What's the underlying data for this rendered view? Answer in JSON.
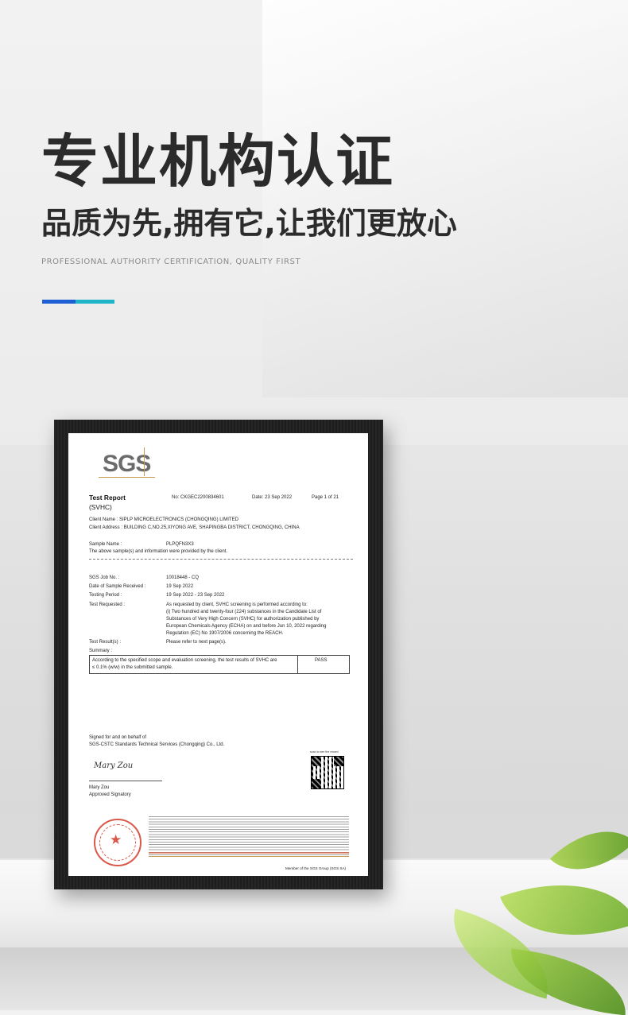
{
  "header": {
    "title": "专业机构认证",
    "subtitle": "品质为先,拥有它,让我们更放心",
    "tagline": "PROFESSIONAL AUTHORITY CERTIFICATION, QUALITY FIRST",
    "accent_colors": [
      "#1f5fd6",
      "#1fb4c8"
    ]
  },
  "certificate": {
    "logo": "SGS",
    "report_title_1": "Test Report",
    "report_title_2": "(SVHC)",
    "report_no": "No: CKGEC2200834601",
    "date": "Date: 23 Sep 2022",
    "page": "Page 1 of 21",
    "client_name": "Client Name :    SIPLP MICROELECTRONICS (CHONGQING) LIMITED",
    "client_address": "Client Address : BUILDING C,NO.25,XIYONG AVE, SHAPINGBA DISTRICT, CHONGQING, CHINA",
    "sample_name_label": "Sample Name :",
    "sample_name_value": "PLPQFN3X3",
    "sample_note": "The above sample(s) and information were provided by the client.",
    "job_no_label": "SGS Job No. :",
    "job_no_value": "10018448 - CQ",
    "date_received_label": "Date of Sample Received :",
    "date_received_value": "19 Sep 2022",
    "testing_period_label": "Testing Period :",
    "testing_period_value": "19 Sep 2022 - 23 Sep 2022",
    "test_requested_label": "Test Requested :",
    "test_requested_lines": [
      "As requested by client, SVHC screening is performed according to:",
      "(i) Two hundred and twenty-four (224) substances in the Candidate List of",
      "Substances of Very High Concern (SVHC) for authorization published by",
      "European Chemicals Agency (ECHA) on and before Jun 10, 2022 regarding",
      "Regulation (EC) No 1907/2006 concerning the REACH."
    ],
    "test_results_label": "Test Result(s) :",
    "test_results_value": "Please refer to next page(s).",
    "summary_label": "Summary :",
    "summary_text_1": "According to the specified scope and evaluation screening, the test results of SVHC are",
    "summary_text_2": "≤ 0.1% (w/w) in the submitted sample.",
    "summary_result": "PASS",
    "signed_1": "Signed for and on behalf of",
    "signed_2": "SGS-CSTC Standards Technical Services (Chongqing) Co., Ltd.",
    "signature": "Mary Zou",
    "signatory_name": "Mary Zou",
    "signatory_title": "Approved Signatory",
    "qr_caption": "scan to see the record",
    "footer_member": "Member of the SGS Group (SGS SA)"
  }
}
